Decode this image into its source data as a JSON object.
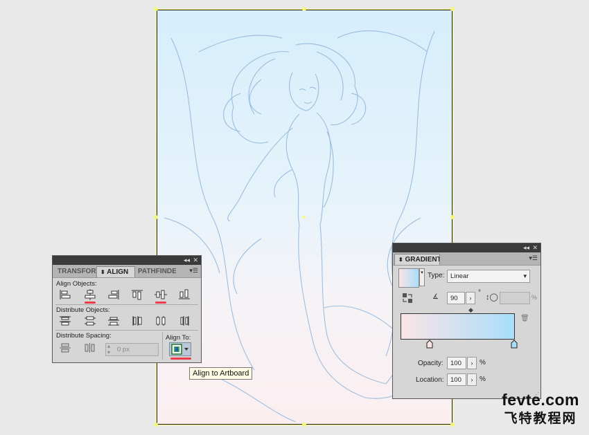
{
  "align_panel": {
    "tabs": [
      "TRANSFOR",
      "ALIGN",
      "PATHFINDE"
    ],
    "align_objects_label": "Align Objects:",
    "distribute_objects_label": "Distribute Objects:",
    "distribute_spacing_label": "Distribute Spacing:",
    "align_to_label": "Align To:",
    "spacing_value": "0 px",
    "collapse_glyph": "◂◂",
    "close_glyph": "✕"
  },
  "tooltip": {
    "text": "Align to Artboard"
  },
  "gradient_panel": {
    "title": "GRADIENT",
    "type_label": "Type:",
    "type_value": "Linear",
    "angle_value": "90",
    "angle_unit": "°",
    "aspect_unit": "%",
    "opacity_label": "Opacity:",
    "opacity_value": "100",
    "opacity_unit": "%",
    "location_label": "Location:",
    "location_value": "100",
    "location_unit": "%",
    "gradient_start_color": "#fbe4e6",
    "gradient_end_color": "#a9defa"
  },
  "watermark": {
    "line1": "fevte.com",
    "line2": "飞特教程网"
  },
  "colors": {
    "highlight": "#ee3a4a",
    "selection": "#f7fa7a"
  }
}
